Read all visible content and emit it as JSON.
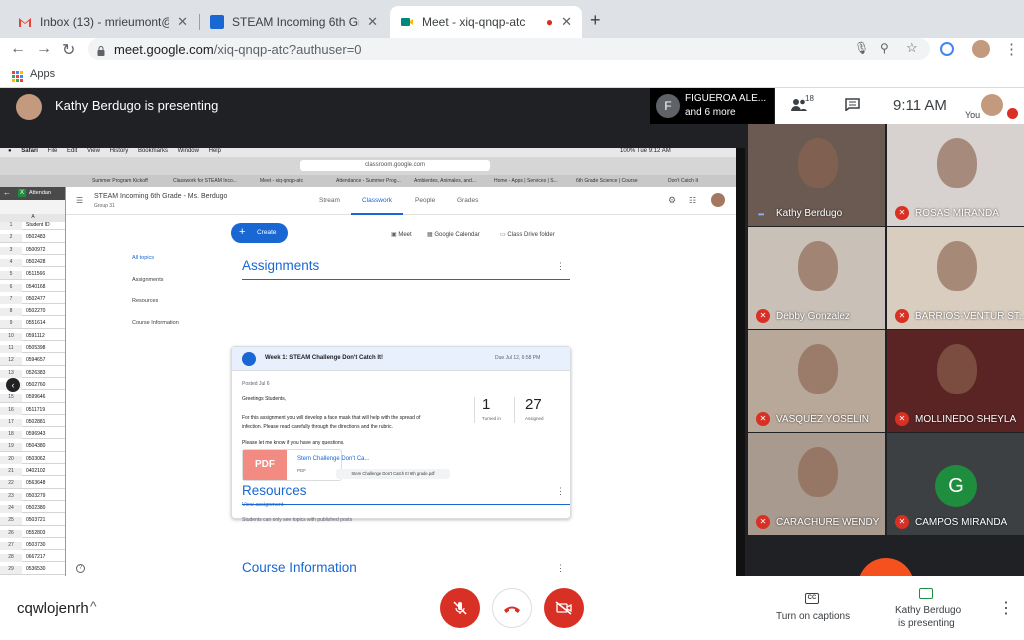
{
  "browser": {
    "tabs": [
      {
        "title": "Inbox (13) - mrieumont@mccs",
        "icon": "gmail-icon",
        "close": "✕"
      },
      {
        "title": "STEAM Incoming 6th Grade - M",
        "icon": "classroom-icon",
        "close": "✕"
      },
      {
        "title": "Meet - xiq-qnqp-atc",
        "icon": "meet-icon",
        "close": "✕",
        "recording": "●"
      }
    ],
    "new_tab": "+",
    "url_host": "meet.google.com",
    "url_path": "/xiq-qnqp-atc?authuser=0",
    "bookmarks_apps": "Apps"
  },
  "meet_top": {
    "presenting_title": "Kathy Berdugo is presenting",
    "chip_initial": "F",
    "chip_name": "FIGUEROA ALE...",
    "chip_more": "and 6 more",
    "people_count": "18",
    "clock": "9:11 AM",
    "you_label": "You"
  },
  "shared_screen": {
    "mac_menu": [
      "Safari",
      "File",
      "Edit",
      "View",
      "History",
      "Bookmarks",
      "Window",
      "Help"
    ],
    "mac_status": "100%  Tue 9:12 AM",
    "safari_url": "classroom.google.com",
    "safari_tabs": [
      "Summer Program Kickoff",
      "Classwork for STEAM Inco...",
      "Meet - xiq-qnqp-atc",
      "Attendance - Summer Prog...",
      "Ambientes, Animales, and...",
      "Home - Apps | Services | S...",
      "6th Grade Science | Course",
      "Don't Catch It"
    ],
    "sheet": {
      "tab_label": "Attendan",
      "col_head": "A",
      "header_cell": "Student ID",
      "rows": [
        {
          "n": "1",
          "v": "Student ID"
        },
        {
          "n": "2",
          "v": "0502483"
        },
        {
          "n": "3",
          "v": "0500972"
        },
        {
          "n": "4",
          "v": "0502428"
        },
        {
          "n": "5",
          "v": "0511566"
        },
        {
          "n": "6",
          "v": "0540168"
        },
        {
          "n": "7",
          "v": "0502477"
        },
        {
          "n": "8",
          "v": "0502270"
        },
        {
          "n": "9",
          "v": "0551614"
        },
        {
          "n": "10",
          "v": "0591112"
        },
        {
          "n": "11",
          "v": "0505398"
        },
        {
          "n": "12",
          "v": "0594657"
        },
        {
          "n": "13",
          "v": "0526383"
        },
        {
          "n": "14",
          "v": "0502760"
        },
        {
          "n": "15",
          "v": "0599646"
        },
        {
          "n": "16",
          "v": "0511719"
        },
        {
          "n": "17",
          "v": "0502881"
        },
        {
          "n": "18",
          "v": "0596943"
        },
        {
          "n": "19",
          "v": "0504380"
        },
        {
          "n": "20",
          "v": "0503062"
        },
        {
          "n": "21",
          "v": "0402102"
        },
        {
          "n": "22",
          "v": "0563648"
        },
        {
          "n": "23",
          "v": "0503279"
        },
        {
          "n": "24",
          "v": "0502380"
        },
        {
          "n": "25",
          "v": "0503721"
        },
        {
          "n": "26",
          "v": "0552803"
        },
        {
          "n": "27",
          "v": "0503730"
        },
        {
          "n": "28",
          "v": "0667217"
        },
        {
          "n": "29",
          "v": "0536530"
        },
        {
          "n": "30",
          "v": "0526535"
        }
      ]
    },
    "classroom": {
      "class_title": "STEAM Incoming 6th Grade - Ms. Berdugo",
      "class_sub": "Group 31",
      "tabs": [
        "Stream",
        "Classwork",
        "People",
        "Grades"
      ],
      "create_label": "Create",
      "links": [
        "Meet",
        "Google Calendar",
        "Class Drive folder"
      ],
      "side_topics": [
        "All topics",
        "Assignments",
        "Resources",
        "Course Information"
      ],
      "assignments_title": "Assignments",
      "card": {
        "title": "Week 1: STEAM Challenge Don't Catch It!",
        "due": "Due Jul 12, 6:58 PM",
        "posted": "Posted Jul 6",
        "greeting": "Greetings Students,",
        "body1": "For this assignment you will develop a face mask that will help with the spread of",
        "body2": "infection. Please read carefully through the directions and the rubric.",
        "body3": "Please let me know if you have any questions.",
        "turned_in_num": "1",
        "turned_in_label": "Turned in",
        "assigned_num": "27",
        "assigned_label": "Assigned",
        "pdf_thumb": "PDF",
        "pdf_name": "Stem Challenge Don't Ca...",
        "pdf_type": "PDF",
        "tooltip": "Stem Challenge Don't Catch It! 6th grade.pdf",
        "view_link": "View assignment"
      },
      "resources_title": "Resources",
      "students_note": "Students can only see topics with published posts",
      "course_info_title": "Course Information"
    }
  },
  "participants": [
    {
      "name": "Kathy Berdugo",
      "muted": false,
      "photo": "#6b5a52"
    },
    {
      "name": "ROSAS MIRANDA",
      "muted": true,
      "photo": "#d7d2cf"
    },
    {
      "name": "Debby Gonzalez",
      "muted": true,
      "photo": "#c9c0b7"
    },
    {
      "name": "BARRIOS-VENTUR ST...",
      "muted": true,
      "photo": "#d9cdbf"
    },
    {
      "name": "VASQUEZ YOSELIN",
      "muted": true,
      "photo": "#b8a89a"
    },
    {
      "name": "MOLLINEDO SHEYLA",
      "muted": true,
      "photo": "#5a2424"
    },
    {
      "name": "CARACHURE WENDY",
      "muted": true,
      "photo": "#a89a8f"
    },
    {
      "name": "CAMPOS MIRANDA",
      "muted": true,
      "photo": "#3c4043",
      "initial": "G"
    }
  ],
  "bottom": {
    "meeting_code": "cqwlojenrh",
    "chevron": "^",
    "captions_label": "Turn on captions",
    "cc_text": "CC",
    "presenting_line1": "Kathy Berdugo",
    "presenting_line2": "is presenting",
    "more": "⋮"
  },
  "colors": {
    "meet_red": "#d93025",
    "classroom_blue": "#1967d2",
    "dark_bg": "#202124"
  }
}
